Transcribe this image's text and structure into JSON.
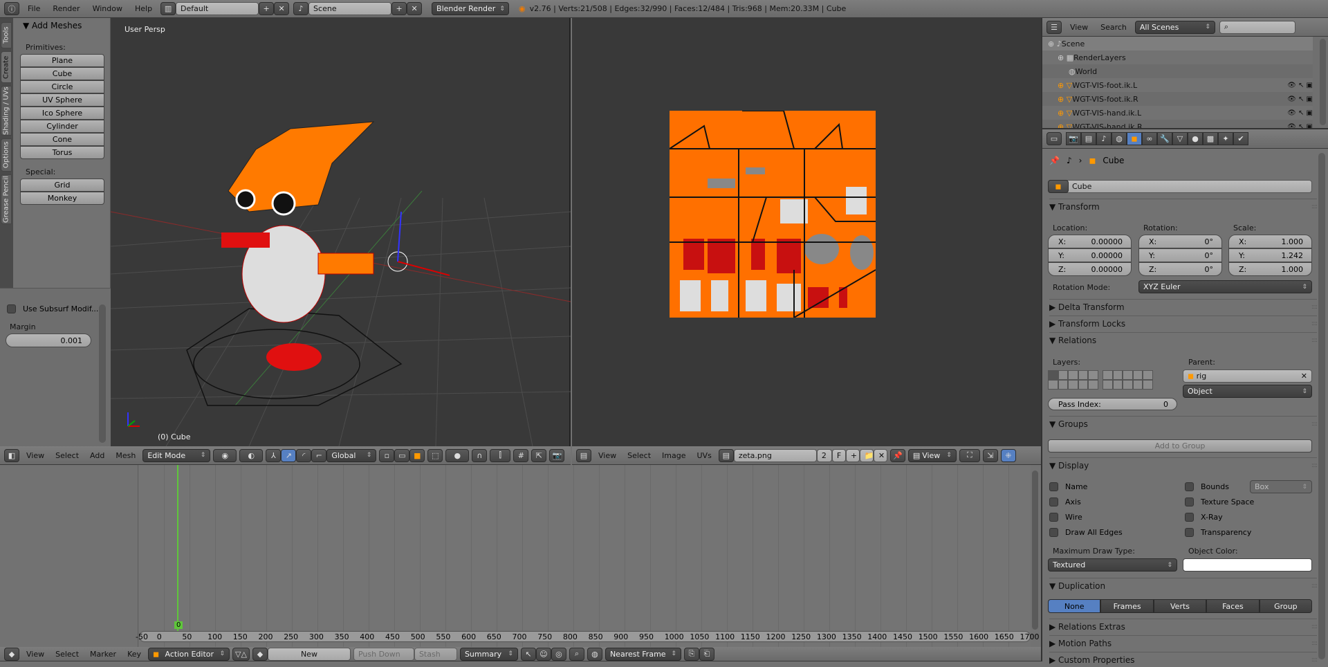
{
  "topbar": {
    "menus": [
      "File",
      "Render",
      "Window",
      "Help"
    ],
    "layout": "Default",
    "scene": "Scene",
    "engine": "Blender Render",
    "stats": "v2.76 | Verts:21/508 | Edges:32/990 | Faces:12/484 | Tris:968 | Mem:20.33M | Cube"
  },
  "toolshelf": {
    "tabs": [
      "Tools",
      "Create",
      "Shading / UVs",
      "Options",
      "Grease Pencil"
    ],
    "active_tab": "Create",
    "panel_title": "Add Meshes",
    "primitives_label": "Primitives:",
    "primitives": [
      "Plane",
      "Cube",
      "Circle",
      "UV Sphere",
      "Ico Sphere",
      "Cylinder",
      "Cone",
      "Torus"
    ],
    "special_label": "Special:",
    "special": [
      "Grid",
      "Monkey"
    ],
    "subsurf_label": "Use Subsurf Modif...",
    "margin_label": "Margin",
    "margin_value": "0.001"
  },
  "viewport3d": {
    "view_label": "User Persp",
    "object_label": "(0) Cube",
    "header": {
      "menus": [
        "View",
        "Select",
        "Add",
        "Mesh"
      ],
      "mode": "Edit Mode",
      "orientation": "Global"
    }
  },
  "uv_editor": {
    "header": {
      "menus": [
        "View",
        "Select",
        "Image",
        "UVs"
      ],
      "image_name": "zeta.png",
      "users": "2",
      "fake": "F",
      "view_mode": "View"
    },
    "texture_color": "#ff7000"
  },
  "timeline": {
    "current_frame": "0",
    "ticks": [
      "-50",
      "0",
      "50",
      "100",
      "150",
      "200",
      "250",
      "300",
      "350",
      "400",
      "450",
      "500",
      "550",
      "600",
      "650",
      "700",
      "750",
      "800",
      "850",
      "900",
      "950",
      "1000",
      "1050",
      "1100",
      "1150",
      "1200",
      "1250",
      "1300",
      "1350",
      "1400",
      "1450",
      "1500",
      "1550",
      "1600",
      "1650",
      "1700"
    ],
    "header": {
      "menus": [
        "View",
        "Select",
        "Marker",
        "Key"
      ],
      "editor_mode": "Action Editor",
      "new_label": "New",
      "push_down": "Push Down",
      "stash": "Stash",
      "summary": "Summary",
      "snap": "Nearest Frame"
    }
  },
  "outliner": {
    "menus": [
      "View",
      "Search"
    ],
    "filter": "All Scenes",
    "search_placeholder": "",
    "items": [
      {
        "label": "Scene",
        "icon": "scene-icon"
      },
      {
        "label": "RenderLayers",
        "icon": "renderlayers-icon"
      },
      {
        "label": "World",
        "icon": "world-icon"
      },
      {
        "label": "WGT-VIS-foot.ik.L",
        "icon": "mesh-icon"
      },
      {
        "label": "WGT-VIS-foot.ik.R",
        "icon": "mesh-icon"
      },
      {
        "label": "WGT-VIS-hand.ik.L",
        "icon": "mesh-icon"
      },
      {
        "label": "WGT-VIS-hand.ik.R",
        "icon": "mesh-icon"
      }
    ]
  },
  "properties": {
    "context_tabs": [
      "render",
      "render-layers",
      "scene",
      "world",
      "object",
      "constraints",
      "modifiers",
      "data",
      "material",
      "texture",
      "particles",
      "physics"
    ],
    "active_tab": "object",
    "breadcrumb": "Cube",
    "object_name": "Cube",
    "transform": {
      "title": "Transform",
      "location_label": "Location:",
      "rotation_label": "Rotation:",
      "scale_label": "Scale:",
      "location": [
        [
          "X:",
          "0.00000"
        ],
        [
          "Y:",
          "0.00000"
        ],
        [
          "Z:",
          "0.00000"
        ]
      ],
      "rotation": [
        [
          "X:",
          "0°"
        ],
        [
          "Y:",
          "0°"
        ],
        [
          "Z:",
          "0°"
        ]
      ],
      "scale": [
        [
          "X:",
          "1.000"
        ],
        [
          "Y:",
          "1.242"
        ],
        [
          "Z:",
          "1.000"
        ]
      ],
      "rotation_mode_label": "Rotation Mode:",
      "rotation_mode": "XYZ Euler"
    },
    "collapsed1": [
      "Delta Transform",
      "Transform Locks"
    ],
    "relations": {
      "title": "Relations",
      "layers_label": "Layers:",
      "parent_label": "Parent:",
      "parent": "rig",
      "parent_type": "Object",
      "pass_index_label": "Pass Index:",
      "pass_index": "0"
    },
    "groups": {
      "title": "Groups",
      "add_label": "Add to Group"
    },
    "display": {
      "title": "Display",
      "left": [
        "Name",
        "Axis",
        "Wire",
        "Draw All Edges"
      ],
      "right": [
        "Bounds",
        "Texture Space",
        "X-Ray",
        "Transparency"
      ],
      "bounds_type": "Box",
      "max_draw_label": "Maximum Draw Type:",
      "max_draw": "Textured",
      "color_label": "Object Color:",
      "object_color": "#ffffff"
    },
    "duplication": {
      "title": "Duplication",
      "options": [
        "None",
        "Frames",
        "Verts",
        "Faces",
        "Group"
      ],
      "active": "None"
    },
    "collapsed2": [
      "Relations Extras",
      "Motion Paths",
      "Custom Properties"
    ],
    "accent": "#5680c2"
  }
}
